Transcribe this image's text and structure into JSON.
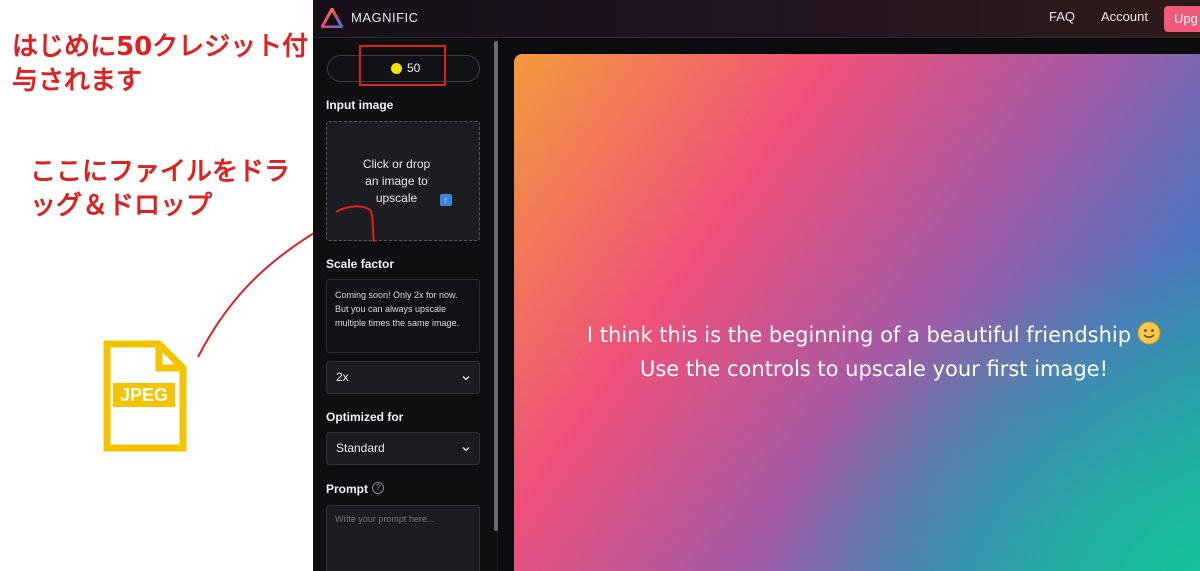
{
  "annotations": {
    "credits_note": "はじめに50クレジット付与されます",
    "drop_note": "ここにファイルをドラッグ＆ドロップ",
    "file_icon_label": "JPEG",
    "accent_color": "#e0201f"
  },
  "header": {
    "brand": "MAGNIFIC",
    "nav": {
      "faq": "FAQ",
      "account": "Account",
      "upgrade": "Upg"
    }
  },
  "sidebar": {
    "credits": "50",
    "input_image": {
      "label": "Input image",
      "dropzone_text": "Click or drop an image to upscale"
    },
    "scale_factor": {
      "label": "Scale factor",
      "note": "Coming soon! Only 2x for now. But you can always upscale multiple times the same image.",
      "selected": "2x"
    },
    "optimized_for": {
      "label": "Optimized for",
      "selected": "Standard"
    },
    "prompt": {
      "label": "Prompt",
      "placeholder": "Write your prompt here..."
    }
  },
  "main": {
    "line1": "I think this is the beginning of a beautiful friendship",
    "line2": "Use the controls to upscale your first image!"
  }
}
